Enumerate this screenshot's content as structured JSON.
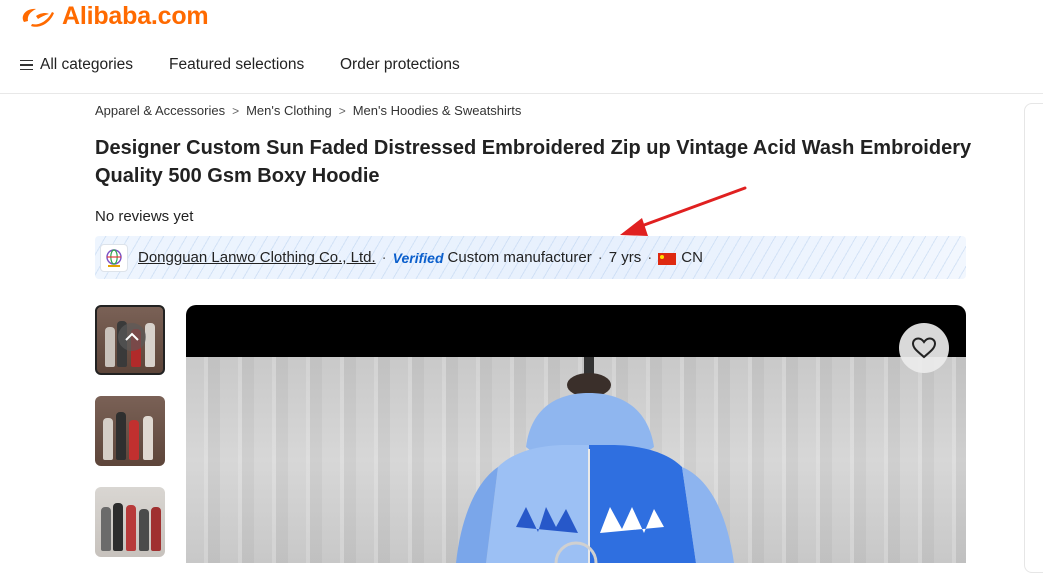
{
  "header": {
    "logo_text": "Alibaba.com",
    "brand_color": "#ff6a00"
  },
  "nav": {
    "items": [
      {
        "label": "All categories",
        "icon": "hamburger-icon"
      },
      {
        "label": "Featured selections"
      },
      {
        "label": "Order protections"
      }
    ]
  },
  "breadcrumb": [
    "Apparel & Accessories",
    "Men's Clothing",
    "Men's Hoodies & Sweatshirts"
  ],
  "breadcrumb_separator": ">",
  "product": {
    "title": "Designer Custom Sun Faded Distressed Embroidered Zip up Vintage Acid Wash Embroidery Quality 500 Gsm Boxy Hoodie",
    "reviews": "No reviews yet"
  },
  "supplier": {
    "name": "Dongguan Lanwo Clothing Co., Ltd.",
    "separator": "·",
    "verified_label": "Verified",
    "type": "Custom manufacturer",
    "years": "7 yrs",
    "country": "CN",
    "verified_color": "#0b5fcc"
  },
  "gallery": {
    "thumbnail_count": 3,
    "favorite_icon": "heart-icon"
  },
  "annotation": {
    "arrow_color": "#e02020"
  }
}
